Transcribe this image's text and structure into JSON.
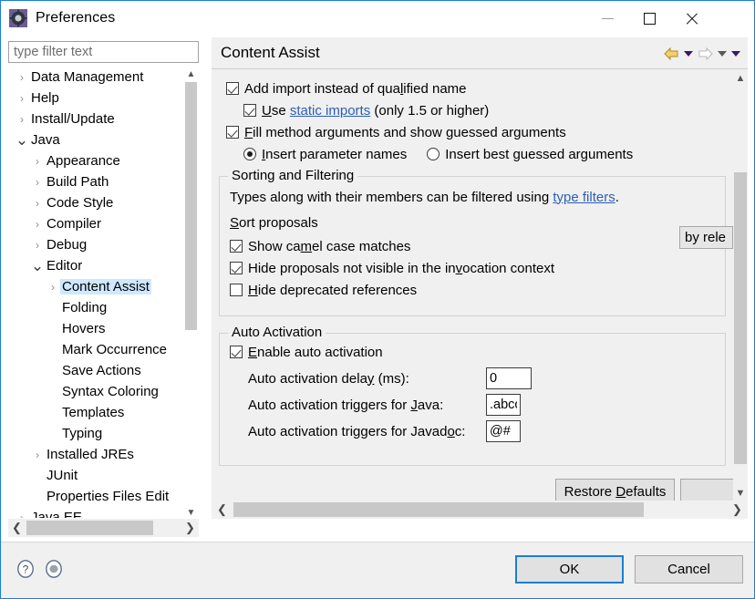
{
  "window": {
    "title": "Preferences",
    "icon": "preferences-gear-icon",
    "controls": {
      "minimize": "—",
      "maximize": "□",
      "close": "✕"
    },
    "accent_color": "#1a7fd4"
  },
  "sidebar": {
    "filter": {
      "placeholder": "type filter text",
      "value": ""
    },
    "items": [
      {
        "label": "Data Management",
        "indent": 0,
        "arrow": "collapsed",
        "selected": false
      },
      {
        "label": "Help",
        "indent": 0,
        "arrow": "collapsed",
        "selected": false
      },
      {
        "label": "Install/Update",
        "indent": 0,
        "arrow": "collapsed",
        "selected": false
      },
      {
        "label": "Java",
        "indent": 0,
        "arrow": "expanded",
        "selected": false
      },
      {
        "label": "Appearance",
        "indent": 1,
        "arrow": "collapsed",
        "selected": false
      },
      {
        "label": "Build Path",
        "indent": 1,
        "arrow": "collapsed",
        "selected": false
      },
      {
        "label": "Code Style",
        "indent": 1,
        "arrow": "collapsed",
        "selected": false
      },
      {
        "label": "Compiler",
        "indent": 1,
        "arrow": "collapsed",
        "selected": false
      },
      {
        "label": "Debug",
        "indent": 1,
        "arrow": "collapsed",
        "selected": false
      },
      {
        "label": "Editor",
        "indent": 1,
        "arrow": "expanded",
        "selected": false
      },
      {
        "label": "Content Assist",
        "indent": 2,
        "arrow": "collapsed",
        "selected": true
      },
      {
        "label": "Folding",
        "indent": 2,
        "arrow": "none",
        "selected": false
      },
      {
        "label": "Hovers",
        "indent": 2,
        "arrow": "none",
        "selected": false
      },
      {
        "label": "Mark Occurrence",
        "indent": 2,
        "arrow": "none",
        "selected": false
      },
      {
        "label": "Save Actions",
        "indent": 2,
        "arrow": "none",
        "selected": false
      },
      {
        "label": "Syntax Coloring",
        "indent": 2,
        "arrow": "none",
        "selected": false
      },
      {
        "label": "Templates",
        "indent": 2,
        "arrow": "none",
        "selected": false
      },
      {
        "label": "Typing",
        "indent": 2,
        "arrow": "none",
        "selected": false
      },
      {
        "label": "Installed JREs",
        "indent": 1,
        "arrow": "collapsed",
        "selected": false
      },
      {
        "label": "JUnit",
        "indent": 1,
        "arrow": "none",
        "selected": false
      },
      {
        "label": "Properties Files Edit",
        "indent": 1,
        "arrow": "none",
        "selected": false
      },
      {
        "label": "Java EE",
        "indent": 0,
        "arrow": "collapsed",
        "selected": false
      }
    ]
  },
  "panel": {
    "title": "Content Assist",
    "nav": {
      "back": "back-arrow-icon",
      "forward": "forward-arrow-icon",
      "menu": "dropdown-caret-icon"
    },
    "top_options": [
      {
        "type": "checkbox",
        "checked": true,
        "label": "Add import instead of qualified name"
      },
      {
        "type": "checkbox",
        "checked": true,
        "label": "Use ",
        "link": "static imports",
        "label_after": " (only 1.5 or higher)"
      },
      {
        "type": "checkbox",
        "checked": true,
        "label": "Fill method arguments and show guessed arguments"
      }
    ],
    "radios": [
      {
        "label": "Insert parameter names",
        "selected": true
      },
      {
        "label": "Insert best guessed arguments",
        "selected": false
      }
    ],
    "sorting_group": {
      "title": "Sorting and Filtering",
      "description_before": "Types along with their members can be filtered using ",
      "description_link": "type filters",
      "description_after": ".",
      "sort_label": "Sort proposals",
      "sort_value": "by rele",
      "checkboxes": [
        {
          "checked": true,
          "label": "Show camel case matches"
        },
        {
          "checked": true,
          "label": "Hide proposals not visible in the invocation context"
        },
        {
          "checked": false,
          "label": "Hide deprecated references"
        }
      ]
    },
    "auto_activation_group": {
      "title": "Auto Activation",
      "enable_label": "Enable auto activation",
      "enable_checked": true,
      "fields": [
        {
          "label": "Auto activation delay (ms):",
          "value": "0"
        },
        {
          "label": "Auto activation triggers for Java:",
          "value": ".abcc"
        },
        {
          "label": "Auto activation triggers for Javadoc:",
          "value": "@#"
        }
      ]
    },
    "restore_defaults_label": "Restore Defaults"
  },
  "footer": {
    "help_icon": "help-question-icon",
    "apply_icon": "apply-disc-icon",
    "ok_label": "OK",
    "cancel_label": "Cancel"
  }
}
